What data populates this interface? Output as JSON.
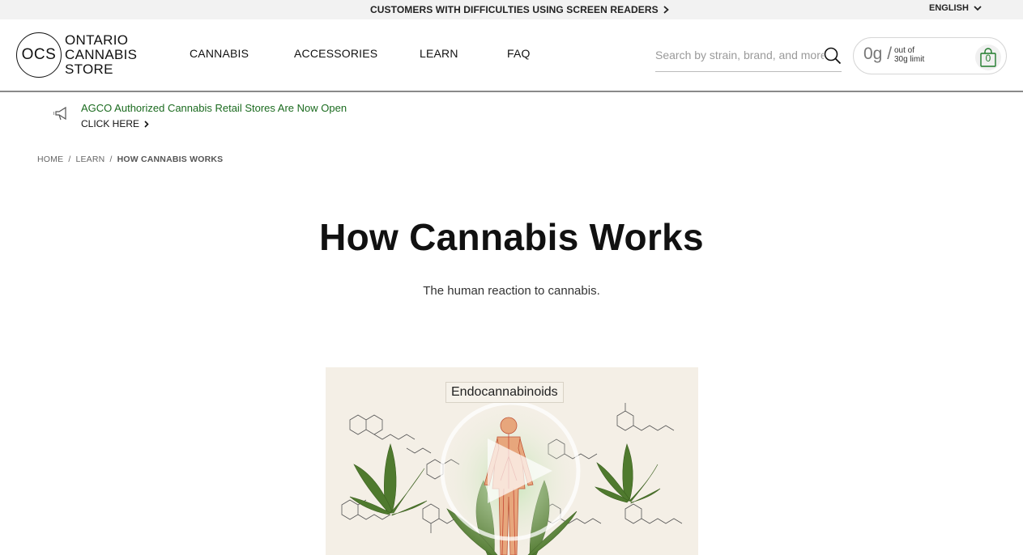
{
  "topbar": {
    "a11y_link": "CUSTOMERS WITH DIFFICULTIES USING SCREEN READERS",
    "language": "ENGLISH"
  },
  "logo": {
    "mark": "OCS",
    "line1": "ONTARIO",
    "line2": "CANNABIS",
    "line3": "STORE"
  },
  "nav": {
    "items": [
      {
        "label": "CANNABIS"
      },
      {
        "label": "ACCESSORIES"
      },
      {
        "label": "LEARN"
      },
      {
        "label": "FAQ"
      }
    ]
  },
  "search": {
    "placeholder": "Search by strain, brand, and more"
  },
  "limit": {
    "amount": "0g /",
    "line1": "out of",
    "line2": "30g limit"
  },
  "cart": {
    "count": "0"
  },
  "announcement": {
    "title": "AGCO Authorized Cannabis Retail Stores Are Now Open",
    "link": "CLICK HERE"
  },
  "breadcrumb": {
    "items": [
      {
        "label": "HOME"
      },
      {
        "label": "LEARN"
      },
      {
        "label": "HOW CANNABIS WORKS"
      }
    ],
    "separator": "/"
  },
  "main": {
    "title": "How Cannabis Works",
    "subtitle": "The human reaction to cannabis."
  },
  "video": {
    "label": "Endocannabinoids"
  },
  "colors": {
    "accent_green": "#1b6b1f",
    "topbar_bg": "#f2f2f2",
    "video_bg": "#f4efe6"
  }
}
